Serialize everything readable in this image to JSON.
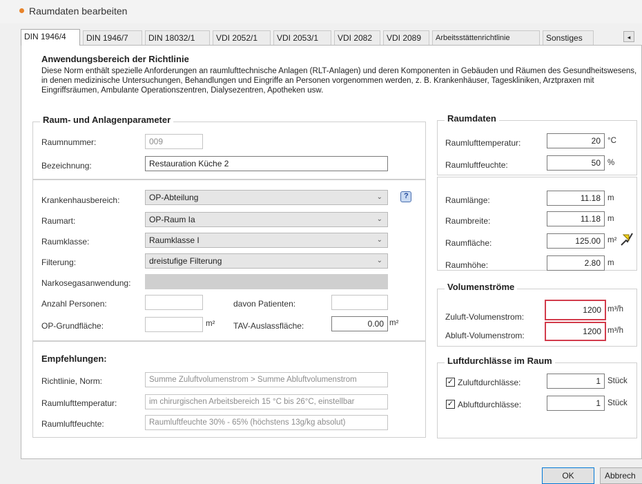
{
  "window": {
    "title": "Raumdaten bearbeiten"
  },
  "tabs": [
    "DIN 1946/4",
    "DIN 1946/7",
    "DIN 18032/1",
    "VDI 2052/1",
    "VDI 2053/1",
    "VDI 2082",
    "VDI 2089",
    "Arbeitsstättenrichtlinie",
    "Sonstiges"
  ],
  "scope": {
    "title": "Anwendungsbereich der Richtlinie",
    "text": "Diese Norm enthält spezielle Anforderungen an raumlufttechnische Anlagen (RLT-Anlagen) und deren Komponenten in Gebäuden und Räumen des Gesundheitswesens, in denen medizinische Untersuchungen, Behandlungen und Eingriffe an Personen vorgenommen werden, z. B. Krankenhäuser, Tageskliniken, Arztpraxen mit Eingriffsräumen, Ambulante Operationszentren, Dialysezentren, Apotheken usw."
  },
  "params": {
    "title": "Raum- und Anlagenparameter",
    "raumnummer_label": "Raumnummer:",
    "raumnummer_value": "009",
    "bezeichnung_label": "Bezeichnung:",
    "bezeichnung_value": "Restauration Küche 2",
    "krankenhausbereich_label": "Krankenhausbereich:",
    "krankenhausbereich_value": "OP-Abteilung",
    "raumart_label": "Raumart:",
    "raumart_value": "OP-Raum Ia",
    "raumklasse_label": "Raumklasse:",
    "raumklasse_value": "Raumklasse I",
    "filterung_label": "Filterung:",
    "filterung_value": "dreistufige Filterung",
    "narkose_label": "Narkosegasanwendung:",
    "personen_label": "Anzahl Personen:",
    "personen_value": "",
    "patienten_label": "davon Patienten:",
    "patienten_value": "",
    "op_grundflaeche_label": "OP-Grundfläche:",
    "op_grundflaeche_value": "",
    "op_grundflaeche_unit": "m²",
    "tav_label": "TAV-Auslassfläche:",
    "tav_value": "0.00",
    "tav_unit": "m²"
  },
  "recommend": {
    "title": "Empfehlungen:",
    "rows": [
      {
        "label": "Richtlinie, Norm:",
        "value": "Summe Zuluftvolumenstrom > Summe Abluftvolumenstrom"
      },
      {
        "label": "Raumlufttemperatur:",
        "value": "im chirurgischen Arbeitsbereich 15 °C bis 26°C, einstellbar"
      },
      {
        "label": "Raumluftfeuchte:",
        "value": "Raumluftfeuchte 30% - 65% (höchstens 13g/kg absolut)"
      }
    ]
  },
  "raumdaten": {
    "title": "Raumdaten",
    "temp_label": "Raumlufttemperatur:",
    "temp_value": "20",
    "temp_unit": "°C",
    "feuchte_label": "Raumluftfeuchte:",
    "feuchte_value": "50",
    "feuchte_unit": "%",
    "laenge_label": "Raumlänge:",
    "laenge_value": "11.18",
    "laenge_unit": "m",
    "breite_label": "Raumbreite:",
    "breite_value": "11.18",
    "breite_unit": "m",
    "flaeche_label": "Raumfläche:",
    "flaeche_value": "125.00",
    "flaeche_unit": "m²",
    "hoehe_label": "Raumhöhe:",
    "hoehe_value": "2.80",
    "hoehe_unit": "m"
  },
  "volumen": {
    "title": "Volumenströme",
    "zuluft_label": "Zuluft-Volumenstrom:",
    "zuluft_value": "1200",
    "zuluft_unit": "m³/h",
    "abluft_label": "Abluft-Volumenstrom:",
    "abluft_value": "1200",
    "abluft_unit": "m³/h"
  },
  "durchlaesse": {
    "title": "Luftdurchlässe im Raum",
    "zuluft_label": "Zuluftdurchlässe:",
    "zuluft_value": "1",
    "zuluft_checked": true,
    "zuluft_unit": "Stück",
    "abluft_label": "Abluftdurchlässe:",
    "abluft_value": "1",
    "abluft_checked": true,
    "abluft_unit": "Stück"
  },
  "buttons": {
    "ok": "OK",
    "cancel": "Abbrech"
  },
  "colors": {
    "accent_dot": "#e8832a",
    "highlight_border": "#d23c4c"
  }
}
